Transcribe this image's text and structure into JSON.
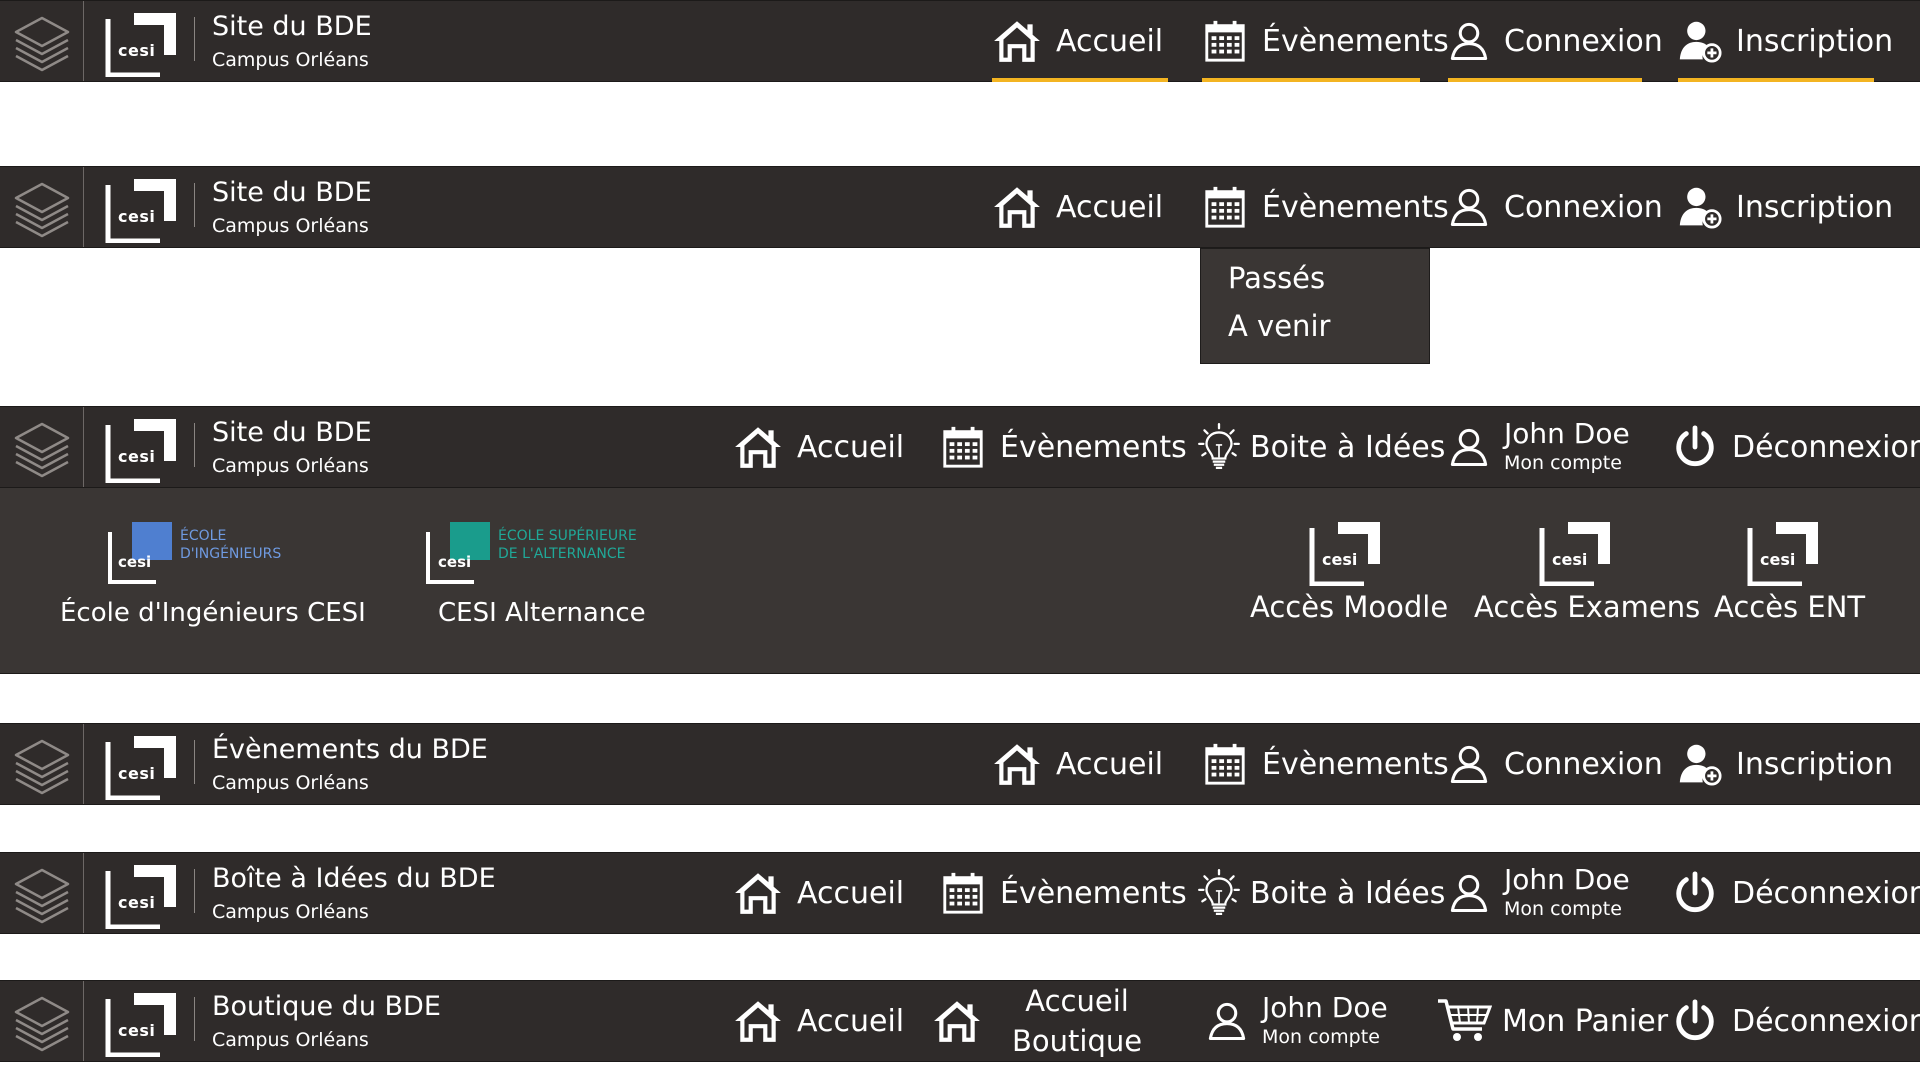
{
  "bars": [
    {
      "title": "Site du BDE",
      "subtitle": "Campus Orléans",
      "logo_text": "cesi",
      "nav": [
        {
          "icon": "home-icon",
          "label": "Accueil"
        },
        {
          "icon": "calendar-icon",
          "label": "Évènements"
        },
        {
          "icon": "user-icon",
          "label": "Connexion"
        },
        {
          "icon": "user-add-icon",
          "label": "Inscription"
        }
      ],
      "active_underline_color": "#f3b421"
    },
    {
      "title": "Site du BDE",
      "subtitle": "Campus Orléans",
      "logo_text": "cesi",
      "nav": [
        {
          "icon": "home-icon",
          "label": "Accueil"
        },
        {
          "icon": "calendar-icon",
          "label": "Évènements"
        },
        {
          "icon": "user-icon",
          "label": "Connexion"
        },
        {
          "icon": "user-add-icon",
          "label": "Inscription"
        }
      ],
      "dropdown": [
        "Passés",
        "A venir"
      ]
    },
    {
      "title": "Site du BDE",
      "subtitle": "Campus Orléans",
      "logo_text": "cesi",
      "nav": [
        {
          "icon": "home-icon",
          "label": "Accueil"
        },
        {
          "icon": "calendar-icon",
          "label": "Évènements"
        },
        {
          "icon": "lightbulb-icon",
          "label": "Boite à Idées"
        },
        {
          "icon": "user-icon",
          "label": "John Doe",
          "sublabel": "Mon compte"
        },
        {
          "icon": "power-icon",
          "label": "Déconnexion"
        }
      ],
      "panel": {
        "schools": [
          {
            "logo_text": "cesi",
            "logo_line1": "ÉCOLE",
            "logo_line2": "D'INGÉNIEURS",
            "accent": "#4f7fd0",
            "label": "École d'Ingénieurs CESI"
          },
          {
            "logo_text": "cesi",
            "logo_line1": "ÉCOLE SUPÉRIEURE",
            "logo_line2": "DE L'ALTERNANCE",
            "accent": "#1a9c8c",
            "label": "CESI Alternance"
          }
        ],
        "links": [
          {
            "logo_text": "cesi",
            "label": "Accès Moodle"
          },
          {
            "logo_text": "cesi",
            "label": "Accès Examens"
          },
          {
            "logo_text": "cesi",
            "label": "Accès ENT"
          }
        ]
      }
    },
    {
      "title": "Évènements du BDE",
      "subtitle": "Campus Orléans",
      "logo_text": "cesi",
      "nav": [
        {
          "icon": "home-icon",
          "label": "Accueil"
        },
        {
          "icon": "calendar-icon",
          "label": "Évènements"
        },
        {
          "icon": "user-icon",
          "label": "Connexion"
        },
        {
          "icon": "user-add-icon",
          "label": "Inscription"
        }
      ]
    },
    {
      "title": "Boîte à Idées du BDE",
      "subtitle": "Campus Orléans",
      "logo_text": "cesi",
      "nav": [
        {
          "icon": "home-icon",
          "label": "Accueil"
        },
        {
          "icon": "calendar-icon",
          "label": "Évènements"
        },
        {
          "icon": "lightbulb-icon",
          "label": "Boite à Idées"
        },
        {
          "icon": "user-icon",
          "label": "John Doe",
          "sublabel": "Mon compte"
        },
        {
          "icon": "power-icon",
          "label": "Déconnexion"
        }
      ]
    },
    {
      "title": "Boutique du BDE",
      "subtitle": "Campus Orléans",
      "logo_text": "cesi",
      "nav": [
        {
          "icon": "home-icon",
          "label": "Accueil"
        },
        {
          "icon": "home-icon",
          "label": "Accueil",
          "sublabel": "Boutique"
        },
        {
          "icon": "user-icon",
          "label": "John Doe",
          "sublabel": "Mon compte"
        },
        {
          "icon": "cart-icon",
          "label": "Mon Panier"
        },
        {
          "icon": "power-icon",
          "label": "Déconnexion"
        }
      ]
    }
  ]
}
